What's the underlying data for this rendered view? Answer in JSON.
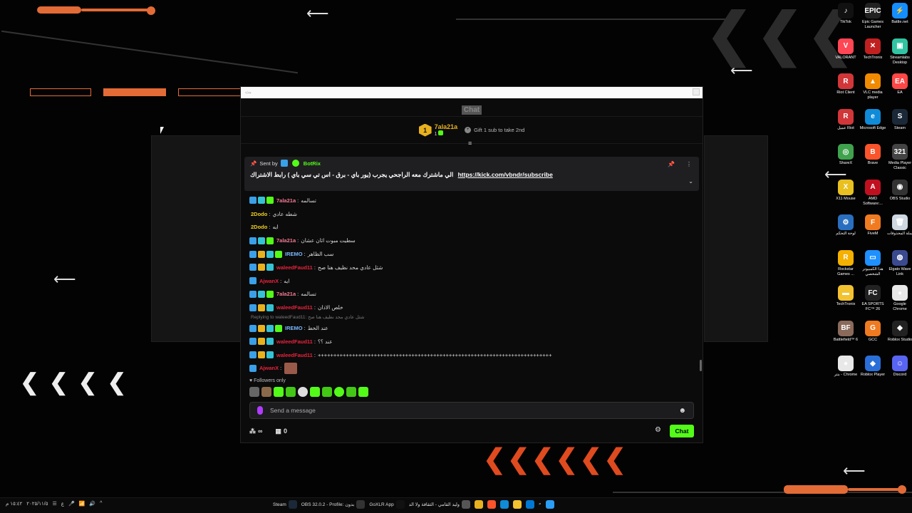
{
  "window": {
    "title": "بث"
  },
  "chat": {
    "header_title": "Chat",
    "top_gifter": {
      "rank": "1",
      "name": "7ala21a",
      "count": "1"
    },
    "gift_prompt": "Gift 1 sub to take 2nd",
    "pinned": {
      "sent_by_label": "Sent by",
      "bot_name": "BotRix",
      "text": "الي ماشترك معه الراجحي يجرب (يور باي - برق - اس تي سي باي ) رابط الاشتراك",
      "link": "https://kick.com/vbndr/subscribe"
    },
    "messages": [
      {
        "user": "7ala21a",
        "color": "#f47c94",
        "badges": [
          "vip",
          "sub",
          "mod"
        ],
        "text": "تسالمه"
      },
      {
        "user": "2Dodo",
        "color": "#f0d020",
        "badges": [],
        "text": "شطه عادي"
      },
      {
        "user": "2Dodo",
        "color": "#f0d020",
        "badges": [],
        "text": "ايه"
      },
      {
        "user": "7ala21a",
        "color": "#f47c94",
        "badges": [
          "vip",
          "sub",
          "mod"
        ],
        "text": "سطيت مبوت اثان عشان"
      },
      {
        "user": "IREMO",
        "color": "#7ab8ff",
        "badges": [
          "vip",
          "og",
          "sub",
          "mod"
        ],
        "text": "سب الظاهر"
      },
      {
        "user": "waleedFaud11",
        "color": "#e8233c",
        "badges": [
          "vip",
          "og",
          "sub"
        ],
        "text": "شثل عادي محد نظيف هنا صح"
      },
      {
        "user": "AjwanX",
        "color": "#e8233c",
        "badges": [
          "vip"
        ],
        "text": "ايه"
      },
      {
        "user": "7ala21a",
        "color": "#f47c94",
        "badges": [
          "vip",
          "sub",
          "mod"
        ],
        "text": "تسالمه"
      },
      {
        "user": "waleedFaud11",
        "color": "#e8233c",
        "badges": [
          "vip",
          "og",
          "sub"
        ],
        "text": "خلص الاذان"
      }
    ],
    "reply_line": "Replying to waleedFaud11: شثل عادي محد نظيف هنا صح",
    "messages2": [
      {
        "user": "IREMO",
        "color": "#7ab8ff",
        "badges": [
          "vip",
          "og",
          "sub",
          "mod"
        ],
        "text": "عند الخط"
      },
      {
        "user": "waleedFaud11",
        "color": "#e8233c",
        "badges": [
          "vip",
          "og",
          "sub"
        ],
        "text": "عند ؟؟"
      },
      {
        "user": "waleedFaud11",
        "color": "#e8233c",
        "badges": [
          "vip",
          "og",
          "sub"
        ],
        "text": "+++++++++++++++++++++++++++++++++++++++++++++++++++++++++++++++++++++++++++"
      },
      {
        "user": "AjwanX",
        "color": "#e8233c",
        "badges": [
          "vip"
        ],
        "text": ""
      }
    ],
    "followers_only": "Followers only",
    "input_placeholder": "Send a message",
    "viewers_label": "∞",
    "points_label": "0",
    "chat_button": "Chat"
  },
  "desktop_icons": [
    {
      "label": "TikTok",
      "color": "#111",
      "glyph": "♪"
    },
    {
      "label": "Epic Games Launcher",
      "color": "#222",
      "glyph": "EPIC"
    },
    {
      "label": "Battle.net",
      "color": "#148eff",
      "glyph": "⚡"
    },
    {
      "label": "VALORANT",
      "color": "#ff4655",
      "glyph": "V"
    },
    {
      "label": "TechTronix",
      "color": "#c02020",
      "glyph": "✕"
    },
    {
      "label": "Streamlabs Desktop",
      "color": "#31c3a2",
      "glyph": "▣"
    },
    {
      "label": "Riot Client",
      "color": "#d13639",
      "glyph": "R"
    },
    {
      "label": "VLC media player",
      "color": "#f08a00",
      "glyph": "▲"
    },
    {
      "label": "EA",
      "color": "#ff4747",
      "glyph": "EA"
    },
    {
      "label": "عميل Riot",
      "color": "#d13639",
      "glyph": "R"
    },
    {
      "label": "Microsoft Edge",
      "color": "#0f8bd8",
      "glyph": "e"
    },
    {
      "label": "Steam",
      "color": "#1b2838",
      "glyph": "S"
    },
    {
      "label": "ShareX",
      "color": "#3fa34d",
      "glyph": "◎"
    },
    {
      "label": "Brave",
      "color": "#fb542b",
      "glyph": "B"
    },
    {
      "label": "Media Player Classic",
      "color": "#444",
      "glyph": "321"
    },
    {
      "label": "X11 Mouse",
      "color": "#e8c020",
      "glyph": "X"
    },
    {
      "label": "AMD Software:...",
      "color": "#c01020",
      "glyph": "A"
    },
    {
      "label": "OBS Studio",
      "color": "#333",
      "glyph": "◉"
    },
    {
      "label": "لوحة التحكم",
      "color": "#2a6fbf",
      "glyph": "⚙"
    },
    {
      "label": "FiveM",
      "color": "#f07a20",
      "glyph": "F"
    },
    {
      "label": "سلة المحذوفات",
      "color": "#cfd8e0",
      "glyph": "🗑"
    },
    {
      "label": "Rockstar Games ...",
      "color": "#f5b000",
      "glyph": "R"
    },
    {
      "label": "هذا الكمبيوتر الشخصي",
      "color": "#1e90ff",
      "glyph": "▭"
    },
    {
      "label": "Elgato Wave Link",
      "color": "#3b4a8f",
      "glyph": "◍"
    },
    {
      "label": "TechTronix",
      "color": "#f2c230",
      "glyph": "▬"
    },
    {
      "label": "EA SPORTS FC™ 26",
      "color": "#222",
      "glyph": "FC"
    },
    {
      "label": "Google Chrome",
      "color": "#e8e8e8",
      "glyph": "●"
    },
    {
      "label": "Battlefield™ 6",
      "color": "#8a6a5a",
      "glyph": "BF"
    },
    {
      "label": "GCC",
      "color": "#f07a20",
      "glyph": "G"
    },
    {
      "label": "Roblox Studio",
      "color": "#222",
      "glyph": "◆"
    },
    {
      "label": "بنتر - Chrome",
      "color": "#e8e8e8",
      "glyph": "●"
    },
    {
      "label": "Roblox Player",
      "color": "#2a6fd8",
      "glyph": "◆"
    },
    {
      "label": "Discord",
      "color": "#5865f2",
      "glyph": "☺"
    }
  ],
  "taskbar": {
    "left_items": [
      "١٥:٤٢ م",
      "٢٠٢٥/١١/٥",
      "☰",
      "ع",
      "🎤",
      "📶",
      "🔊",
      "^"
    ],
    "apps": [
      {
        "label": "Steam",
        "color": "#1b2838"
      },
      {
        "label": "OBS 32.0.2 - Profile: بدون",
        "color": "#333"
      },
      {
        "label": "GoXLR App",
        "color": "#111"
      },
      {
        "label": "وليد القامي - الثقافة ولا الد",
        "color": "#555"
      },
      {
        "label": "",
        "color": "#e8b21e"
      },
      {
        "label": "",
        "color": "#fb542b"
      },
      {
        "label": "",
        "color": "#0f8bd8"
      },
      {
        "label": "",
        "color": "#f2c230"
      },
      {
        "label": "",
        "color": "#0078d4"
      }
    ]
  }
}
